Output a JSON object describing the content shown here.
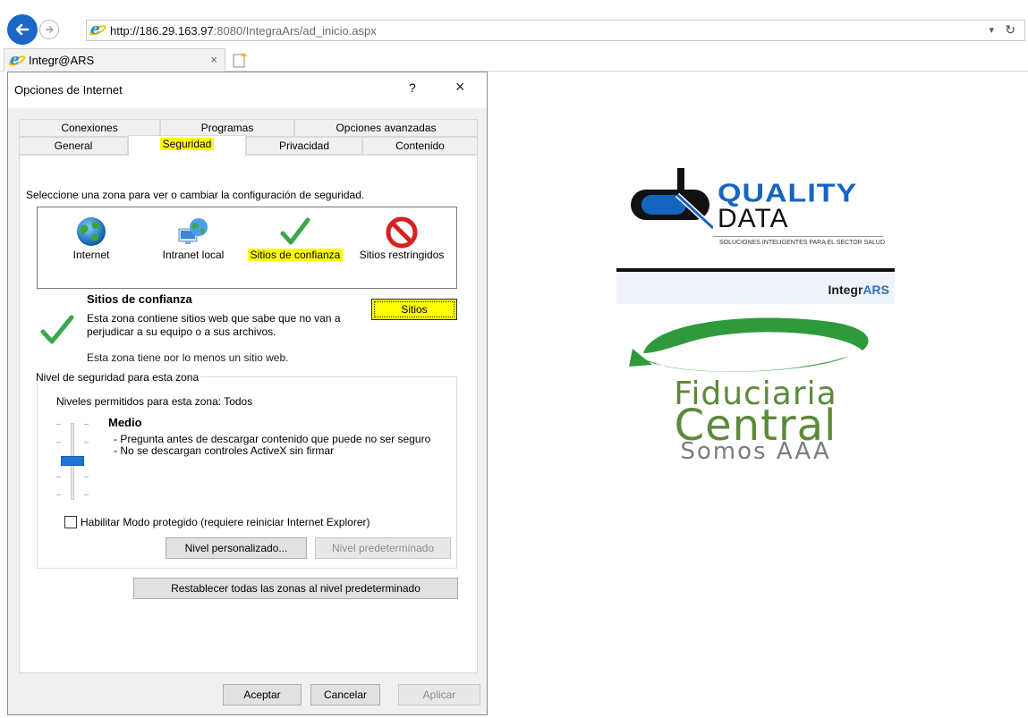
{
  "browser": {
    "url_host": "http://186.29.163.97",
    "url_path": ":8080/IntegraArs/ad_inicio.aspx",
    "tab_title": "Integr@ARS",
    "tab_close": "×",
    "refresh_icon": "↻",
    "dropdown_icon": "▾"
  },
  "dialog": {
    "title": "Opciones de Internet",
    "help": "?",
    "close": "×",
    "tabs_row1": [
      "Conexiones",
      "Programas",
      "Opciones avanzadas"
    ],
    "tabs_row2": [
      "General",
      "Seguridad",
      "Privacidad",
      "Contenido"
    ],
    "active_tab": "Seguridad",
    "zone_prompt": "Seleccione una zona para ver o cambiar la configuración de seguridad.",
    "zones": [
      {
        "label": "Internet",
        "icon": "globe-icon"
      },
      {
        "label": "Intranet local",
        "icon": "network-globe-icon"
      },
      {
        "label": "Sitios de confianza",
        "icon": "checkmark-icon",
        "selected": true
      },
      {
        "label": "Sitios restringidos",
        "icon": "prohibited-icon"
      }
    ],
    "selected_zone": {
      "name": "Sitios de confianza",
      "description": "Esta zona contiene sitios web que sabe que no van a perjudicar a su equipo o a sus archivos.",
      "note": "Esta zona tiene por lo menos un sitio web.",
      "sites_button": "Sitios"
    },
    "level_group": {
      "legend": "Nivel de seguridad para esta zona",
      "allowed": "Niveles permitidos para esta zona: Todos",
      "level_name": "Medio",
      "level_lines": [
        "- Pregunta antes de descargar contenido que puede no ser seguro",
        "- No se descargan controles ActiveX sin firmar"
      ],
      "protected_mode_label": "Habilitar Modo protegido (requiere reiniciar Internet Explorer)",
      "protected_mode_checked": false,
      "custom_level_button": "Nivel personalizado...",
      "default_level_button": "Nivel predeterminado"
    },
    "reset_all_button": "Restablecer todas las zonas al nivel predeterminado",
    "ok_button": "Aceptar",
    "cancel_button": "Cancelar",
    "apply_button": "Aplicar"
  },
  "page": {
    "quality_data": {
      "word1": "QUALITY",
      "word2": "DATA",
      "tagline": "SOLUCIONES INTELIGENTES PARA EL SECTOR SALUD"
    },
    "integrars": {
      "prefix": "Integr",
      "suffix": "ARS"
    },
    "fiduciaria": {
      "line1": "Fiduciaria",
      "line2": "Central",
      "line3": "Somos AAA"
    }
  },
  "colors": {
    "highlight": "#ffff00",
    "ie_blue": "#1a66c7",
    "slider_blue": "#1c78d6",
    "quality_blue": "#1565c0",
    "fiduciaria_green": "#5c8a3a"
  }
}
